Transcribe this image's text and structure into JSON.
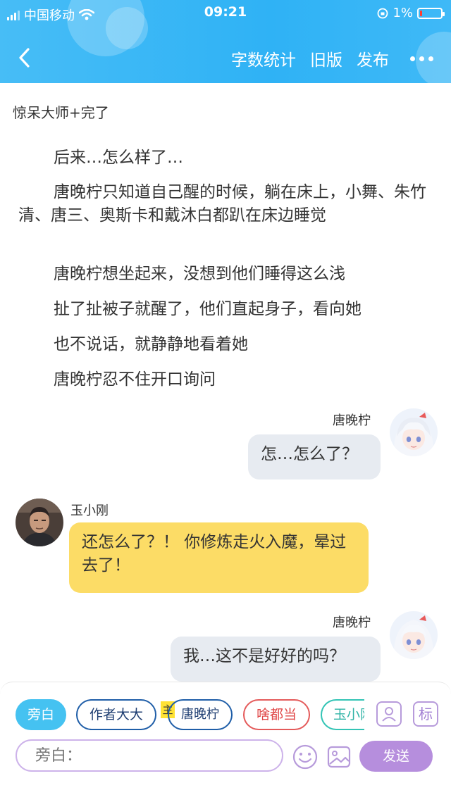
{
  "status_bar": {
    "carrier": "中国移动",
    "time": "09:21",
    "battery": "1%"
  },
  "nav": {
    "word_count": "字数统计",
    "old_version": "旧版",
    "publish": "发布"
  },
  "story_title": "惊呆大师+完了",
  "narration": [
    "后来…怎么样了…",
    "唐晚柠只知道自己醒的时候，躺在床上，小舞、朱竹清、唐三、奥斯卡和戴沐白都趴在床边睡觉",
    "唐晚柠想坐起来，没想到他们睡得这么浅",
    "扯了扯被子就醒了，他们直起身子，看向她",
    "也不说话，就静静地看着她",
    "唐晚柠忍不住开口询问"
  ],
  "messages": [
    {
      "name": "唐晚柠",
      "text": "怎…怎么了？"
    },
    {
      "name": "玉小刚",
      "text": "还怎么了？！ 你修炼走火入魔，晕过去了！"
    },
    {
      "name": "唐晚柠",
      "text": "我…这不是好好的吗？"
    }
  ],
  "roles": {
    "narrator": "旁白",
    "author": "作者大大",
    "main_tag": "主",
    "tang": "唐晚柠",
    "any": "啥都当",
    "yu": "玉小刚"
  },
  "tag_button": "标",
  "input": {
    "placeholder": "旁白：",
    "value": ""
  },
  "send": "发送"
}
